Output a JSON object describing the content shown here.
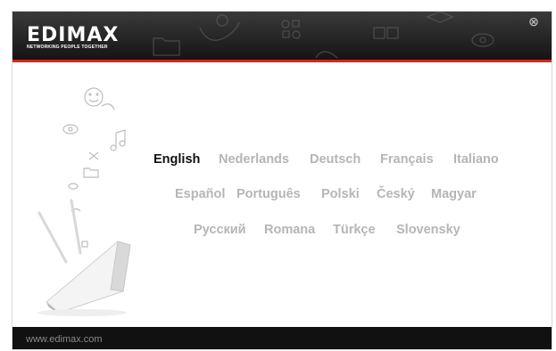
{
  "brand": {
    "logo_text": "EDIMAX",
    "tagline": "NETWORKING PEOPLE TOGETHER"
  },
  "controls": {
    "close_icon": "close-icon"
  },
  "languages": {
    "rows": [
      [
        "English",
        "Nederlands",
        "Deutsch",
        "Français",
        "Italiano"
      ],
      [
        "Español",
        "Português",
        "Polski",
        "Český",
        "Magyar"
      ],
      [
        "Русский",
        "Romana",
        "Türkçe",
        "Slovensky"
      ]
    ],
    "selected": "English"
  },
  "footer": {
    "url": "www.edimax.com"
  },
  "colors": {
    "header": "#2a2a2a",
    "accent_line": "#d32a1e",
    "lang_inactive": "#b5b5b5",
    "lang_active": "#111111",
    "footer": "#111111"
  },
  "icons": [
    "smiley-icon",
    "eye-icon",
    "music-note-icon",
    "folder-icon",
    "email-icon",
    "scissors-icon",
    "gamepad-icon",
    "puzzle-icon",
    "wireless-router-icon"
  ]
}
